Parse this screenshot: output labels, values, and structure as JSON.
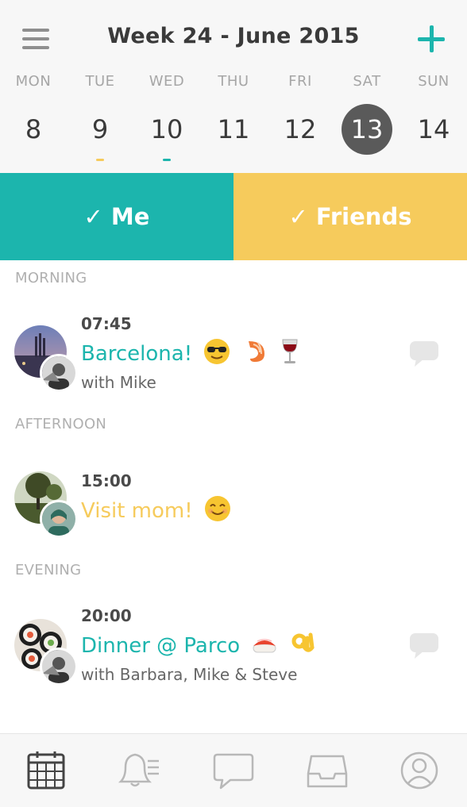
{
  "header": {
    "title": "Week 24 - June 2015"
  },
  "days": [
    {
      "name": "MON",
      "num": "8"
    },
    {
      "name": "TUE",
      "num": "9"
    },
    {
      "name": "WED",
      "num": "10"
    },
    {
      "name": "THU",
      "num": "11"
    },
    {
      "name": "FRI",
      "num": "12"
    },
    {
      "name": "SAT",
      "num": "13",
      "selected": true
    },
    {
      "name": "SUN",
      "num": "14"
    }
  ],
  "filters": {
    "me": "✓ Me",
    "friends": "✓ Friends"
  },
  "colors": {
    "teal": "#1cb5ad",
    "yellow": "#f6cb5c",
    "selected_day": "#5a5a5a"
  },
  "sections": {
    "morning": "MORNING",
    "afternoon": "AFTERNOON",
    "evening": "EVENING"
  },
  "events": [
    {
      "time": "07:45",
      "title": "Barcelona!",
      "with": "with Mike",
      "emojis": [
        "sunglasses-emoji",
        "shrimp-emoji",
        "wine-glass-emoji"
      ]
    },
    {
      "time": "15:00",
      "title": "Visit mom!",
      "with": "",
      "emojis": [
        "smile-emoji"
      ]
    },
    {
      "time": "20:00",
      "title": "Dinner @ Parco",
      "with": "with Barbara, Mike & Steve",
      "emojis": [
        "sushi-emoji",
        "ok-hand-emoji"
      ]
    }
  ],
  "tabs": [
    "calendar-icon",
    "notifications-icon",
    "chat-icon",
    "inbox-icon",
    "profile-icon"
  ]
}
